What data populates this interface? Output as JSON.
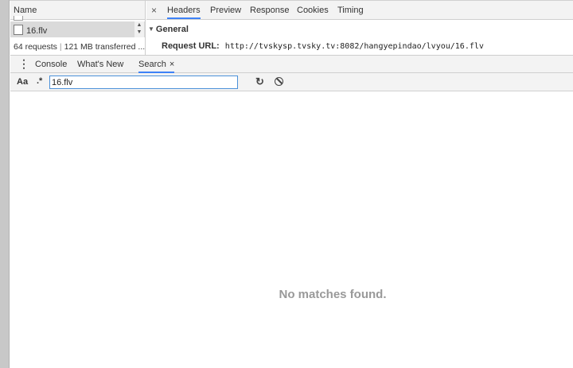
{
  "network": {
    "name_header": "Name",
    "request": {
      "filename": "16.flv"
    },
    "summary": {
      "requests": "64 requests",
      "transferred": "121 MB transferred",
      "more": "..."
    }
  },
  "details": {
    "tabs": [
      "Headers",
      "Preview",
      "Response",
      "Cookies",
      "Timing"
    ],
    "active_tab": "Headers",
    "section_title": "General",
    "request_url_label": "Request URL:",
    "request_url_value": "http://tvskysp.tvsky.tv:8082/hangyepindao/lvyou/16.flv"
  },
  "drawer": {
    "tabs": [
      "Console",
      "What's New",
      "Search"
    ],
    "active_tab": "Search",
    "close_glyph": "×"
  },
  "search": {
    "case_label": "Aa",
    "regex_label": ".*",
    "query": "16.flv"
  },
  "results": {
    "empty_message": "No matches found."
  },
  "colors": {
    "accent": "#3e82f7",
    "toolbar_bg": "#f3f3f3",
    "border": "#d0d0d0",
    "muted_text": "#999999"
  },
  "icons": [
    "close-icon",
    "collapse-triangle-icon",
    "kebab-menu-icon",
    "refresh-icon",
    "clear-icon",
    "file-icon"
  ]
}
